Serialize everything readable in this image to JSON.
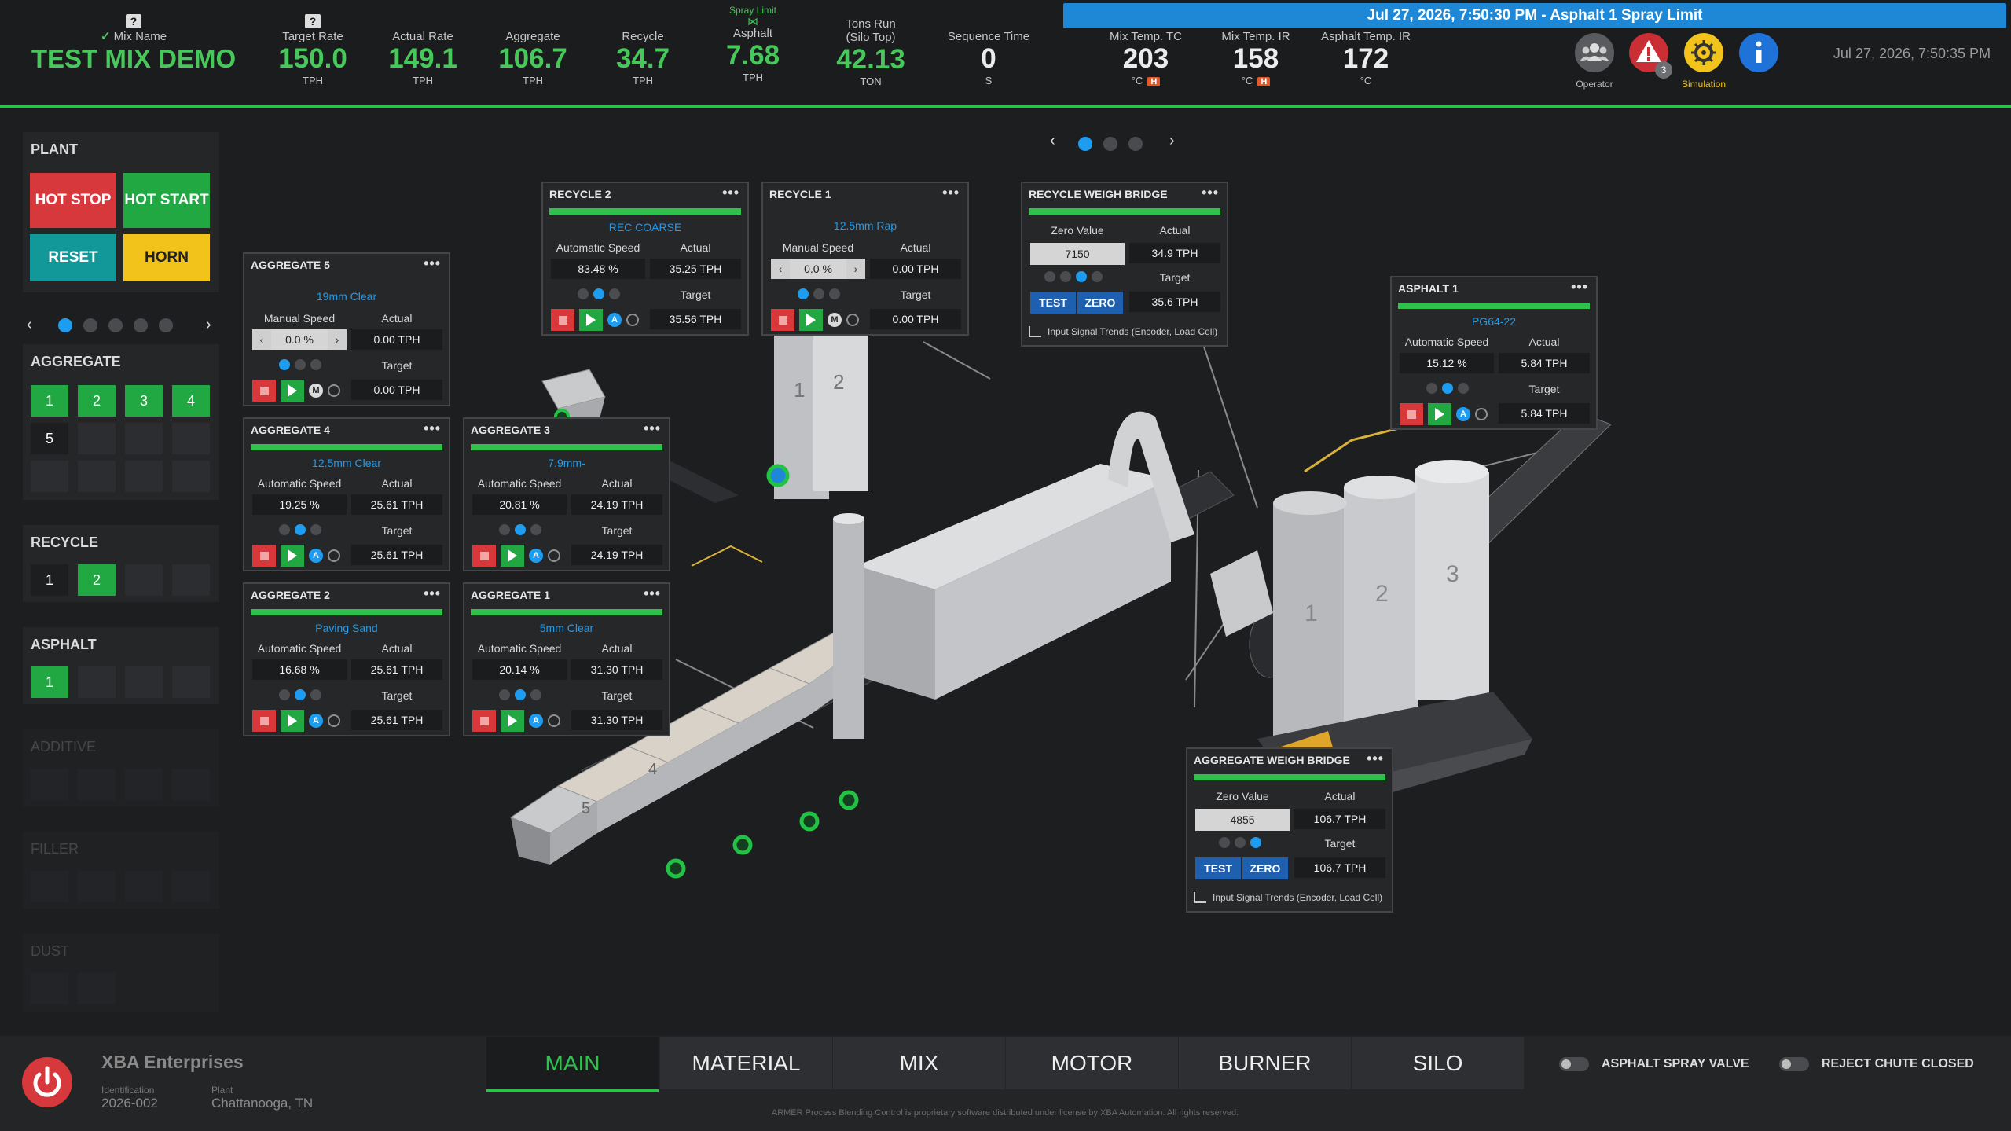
{
  "header": {
    "mix_name_label": "Mix Name",
    "mix_name": "TEST MIX DEMO",
    "kpis": [
      {
        "label": "Target Rate",
        "value": "150.0",
        "unit": "TPH"
      },
      {
        "label": "Actual Rate",
        "value": "149.1",
        "unit": "TPH"
      },
      {
        "label": "Aggregate",
        "value": "106.7",
        "unit": "TPH"
      },
      {
        "label": "Recycle",
        "value": "34.7",
        "unit": "TPH"
      },
      {
        "label": "Asphalt",
        "value": "7.68",
        "unit": "TPH",
        "top_label": "Spray Limit"
      },
      {
        "label": "Tons Run",
        "label2": "(Silo Top)",
        "value": "42.13",
        "unit": "TON"
      },
      {
        "label": "Sequence Time",
        "value": "0",
        "unit": "S"
      }
    ],
    "temps": [
      {
        "label": "Mix Temp. TC",
        "value": "203",
        "unit": "°C",
        "badge": "H"
      },
      {
        "label": "Mix Temp. IR",
        "value": "158",
        "unit": "°C",
        "badge": "H"
      },
      {
        "label": "Asphalt Temp. IR",
        "value": "172",
        "unit": "°C",
        "badge": ""
      }
    ],
    "alarm_banner": "Jul 27, 2026, 7:50:30 PM - Asphalt 1 Spray Limit",
    "operator_label": "Operator",
    "alarm_count": "3",
    "simulation_label": "Simulation",
    "clock": "Jul 27, 2026, 7:50:35 PM"
  },
  "left": {
    "plant_title": "PLANT",
    "hot_stop": "HOT STOP",
    "hot_start": "HOT START",
    "reset": "RESET",
    "horn": "HORN",
    "aggregate_title": "AGGREGATE",
    "aggregate_bins": [
      "1",
      "2",
      "3",
      "4",
      "5"
    ],
    "recycle_title": "RECYCLE",
    "recycle_bins": [
      "1",
      "2"
    ],
    "asphalt_title": "ASPHALT",
    "asphalt_bins": [
      "1"
    ],
    "additive_title": "ADDITIVE",
    "filler_title": "FILLER",
    "dust_title": "DUST"
  },
  "cards": {
    "aggregate5": {
      "title": "AGGREGATE 5",
      "material": "19mm Clear",
      "mode_label": "Manual Speed",
      "actual_label": "Actual",
      "speed": "0.0 %",
      "actual": "0.00 TPH",
      "target_label": "Target",
      "target": "0.00 TPH",
      "mode": "M"
    },
    "aggregate4": {
      "title": "AGGREGATE 4",
      "material": "12.5mm Clear",
      "mode_label": "Automatic Speed",
      "actual_label": "Actual",
      "speed": "19.25 %",
      "actual": "25.61 TPH",
      "target_label": "Target",
      "target": "25.61 TPH",
      "mode": "A"
    },
    "aggregate3": {
      "title": "AGGREGATE 3",
      "material": "7.9mm-",
      "mode_label": "Automatic Speed",
      "actual_label": "Actual",
      "speed": "20.81 %",
      "actual": "24.19 TPH",
      "target_label": "Target",
      "target": "24.19 TPH",
      "mode": "A"
    },
    "aggregate2": {
      "title": "AGGREGATE 2",
      "material": "Paving Sand",
      "mode_label": "Automatic Speed",
      "actual_label": "Actual",
      "speed": "16.68 %",
      "actual": "25.61 TPH",
      "target_label": "Target",
      "target": "25.61 TPH",
      "mode": "A"
    },
    "aggregate1": {
      "title": "AGGREGATE 1",
      "material": "5mm Clear",
      "mode_label": "Automatic Speed",
      "actual_label": "Actual",
      "speed": "20.14 %",
      "actual": "31.30 TPH",
      "target_label": "Target",
      "target": "31.30 TPH",
      "mode": "A"
    },
    "recycle2": {
      "title": "RECYCLE 2",
      "material": "REC COARSE",
      "mode_label": "Automatic Speed",
      "actual_label": "Actual",
      "speed": "83.48 %",
      "actual": "35.25 TPH",
      "target_label": "Target",
      "target": "35.56 TPH",
      "mode": "A"
    },
    "recycle1": {
      "title": "RECYCLE 1",
      "material": "12.5mm Rap",
      "mode_label": "Manual Speed",
      "actual_label": "Actual",
      "speed": "0.0 %",
      "actual": "0.00 TPH",
      "target_label": "Target",
      "target": "0.00 TPH",
      "mode": "M"
    },
    "asphalt1": {
      "title": "ASPHALT 1",
      "material": "PG64-22",
      "mode_label": "Automatic Speed",
      "actual_label": "Actual",
      "speed": "15.12 %",
      "actual": "5.84 TPH",
      "target_label": "Target",
      "target": "5.84 TPH",
      "mode": "A"
    },
    "recycle_bridge": {
      "title": "RECYCLE WEIGH BRIDGE",
      "zero_label": "Zero Value",
      "actual_label": "Actual",
      "zero": "7150",
      "actual": "34.9 TPH",
      "target_label": "Target",
      "target": "35.6 TPH",
      "test": "TEST",
      "zero_btn": "ZERO",
      "trend": "Input Signal Trends (Encoder, Load Cell)"
    },
    "aggregate_bridge": {
      "title": "AGGREGATE WEIGH BRIDGE",
      "zero_label": "Zero Value",
      "actual_label": "Actual",
      "zero": "4855",
      "actual": "106.7 TPH",
      "target_label": "Target",
      "target": "106.7 TPH",
      "test": "TEST",
      "zero_btn": "ZERO",
      "trend": "Input Signal Trends (Encoder, Load Cell)"
    }
  },
  "plant_labels": {
    "silo_1": "1",
    "silo_2": "2",
    "silo_3": "3",
    "tank_1": "1",
    "tank_2": "2",
    "bin_5": "5",
    "bin_4": "4"
  },
  "footer": {
    "company": "XBA Enterprises",
    "id_label": "Identification",
    "id_value": "2026-002",
    "plant_label": "Plant",
    "plant_value": "Chattanooga, TN",
    "tabs": [
      "MAIN",
      "MATERIAL",
      "MIX",
      "MOTOR",
      "BURNER",
      "SILO"
    ],
    "toggle1": "ASPHALT SPRAY VALVE",
    "toggle2": "REJECT CHUTE CLOSED",
    "copyright": "ARMER Process Blending Control is proprietary software distributed under license by XBA Automation. All rights reserved."
  }
}
